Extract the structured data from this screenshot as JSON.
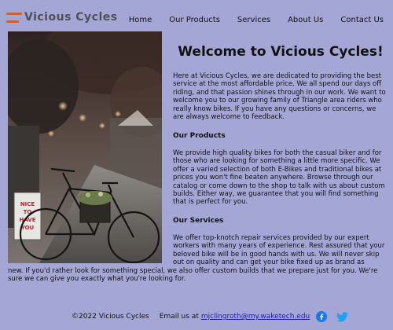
{
  "brand": {
    "name": "Vicious Cycles",
    "accent": "#c9652e"
  },
  "nav": [
    {
      "label": "Home"
    },
    {
      "label": "Our Products"
    },
    {
      "label": "Services"
    },
    {
      "label": "About Us"
    },
    {
      "label": "Contact Us"
    }
  ],
  "hero_image": {
    "alt": "bicycle parked on a street at dusk",
    "sign_text": [
      "NICE",
      "TO",
      "HAVE",
      "YOU"
    ]
  },
  "main": {
    "title": "Welcome to Vicious Cycles!",
    "intro": "Here at Vicious Cycles, we are dedicated to providing the best service at the most affordable price. We all spend our days off riding, and that passion shines through in our work. We want to welcome you to our growing family of Triangle area riders who really know bikes. If you have any questions or concerns, we are always welcome to feedback.",
    "products_heading": "Our Products",
    "products_text": "We provide high quality bikes for both the casual biker and for those who are looking for something a little more specific. We offer a varied selection of both E-Bikes and traditional bikes at prices you won't fine beaten anywhere. Browse through our catalog or come down to the shop to talk with us about custom builds. Either way, we guarantee that you will find something that is perfect for you.",
    "services_heading": "Our Services",
    "services_text_a": "We offer top-knotch repair services provided by our expert workers with many years of experience. Rest assured that your beloved bike will be in good hands with us. We will never skip out on quality and can get your bike fixed up as brand as",
    "services_text_b": "new. If you'd rather look for something special, we also offer custom builds that we prepare just for you. We're sure we can give you exactly what you're looking for."
  },
  "footer": {
    "copyright": "©2022 Vicious Cycles",
    "email_label": "Email us at",
    "email": "mjclingroth@my.waketech.edu",
    "social": [
      {
        "icon": "facebook-icon",
        "color": "#1877f2"
      },
      {
        "icon": "twitter-icon",
        "color": "#1da1f2"
      }
    ]
  }
}
